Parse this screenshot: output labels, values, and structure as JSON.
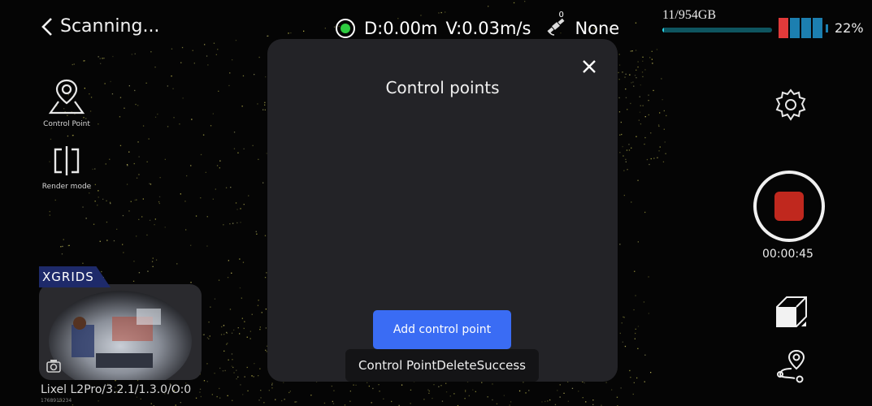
{
  "header": {
    "back_label": "Scanning...",
    "distance": "D:0.00m",
    "velocity": "V:0.03m/s",
    "gnss_count": "0",
    "gnss_status": "None",
    "storage": {
      "label": "11/954GB",
      "fraction": 0.0115
    },
    "battery": {
      "percent_label": "22%",
      "level": 0.22
    }
  },
  "left_tools": {
    "control_point_label": "Control Point",
    "render_mode_label": "Render mode"
  },
  "camera": {
    "brand": "XGRIDS",
    "caption": "Lixel L2Pro/3.2.1/1.3.0/O:0",
    "sub_caption": "1768915234"
  },
  "right_controls": {
    "timer": "00:00:45"
  },
  "modal": {
    "title": "Control points",
    "add_button_label": "Add control point"
  },
  "toast": {
    "message": "Control PointDeleteSuccess"
  },
  "colors": {
    "accent_blue": "#3a6cf4",
    "record_red": "#c0281e",
    "status_green": "#2ecc40",
    "battery_low": "#e23a3a",
    "battery_cell": "#1c7fb0",
    "storage_fill": "#2bd7e8"
  }
}
